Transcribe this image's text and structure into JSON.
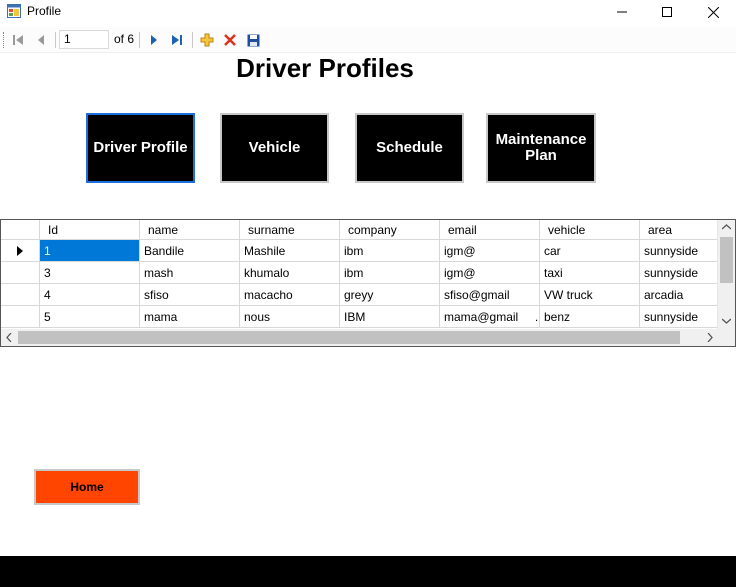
{
  "window": {
    "title": "Profile"
  },
  "navigator": {
    "position": "1",
    "count_label": "of 6"
  },
  "page": {
    "title": "Driver Profiles"
  },
  "nav_buttons": [
    "Driver Profile",
    "Vehicle",
    "Schedule",
    "Maintenance Plan"
  ],
  "grid": {
    "columns": [
      "Id",
      "name",
      "surname",
      "company",
      "email",
      "vehicle",
      "area"
    ],
    "rows": [
      [
        "1",
        "Bandile",
        "Mashile",
        "ibm",
        "igm@",
        "car",
        "sunnyside"
      ],
      [
        "3",
        "mash",
        "khumalo",
        "ibm",
        "igm@",
        "taxi",
        "sunnyside"
      ],
      [
        "4",
        "sfiso",
        "macacho",
        "greyy",
        "sfiso@gmail",
        "VW truck",
        "arcadia"
      ],
      [
        "5",
        "mama",
        "nous",
        "IBM",
        "mama@gmail     ...",
        "benz",
        "sunnyside"
      ]
    ]
  },
  "home_button": {
    "label": "Home"
  },
  "colors": {
    "accent": "#0078d7",
    "home": "#ff4500",
    "nav_bg": "#000000"
  }
}
